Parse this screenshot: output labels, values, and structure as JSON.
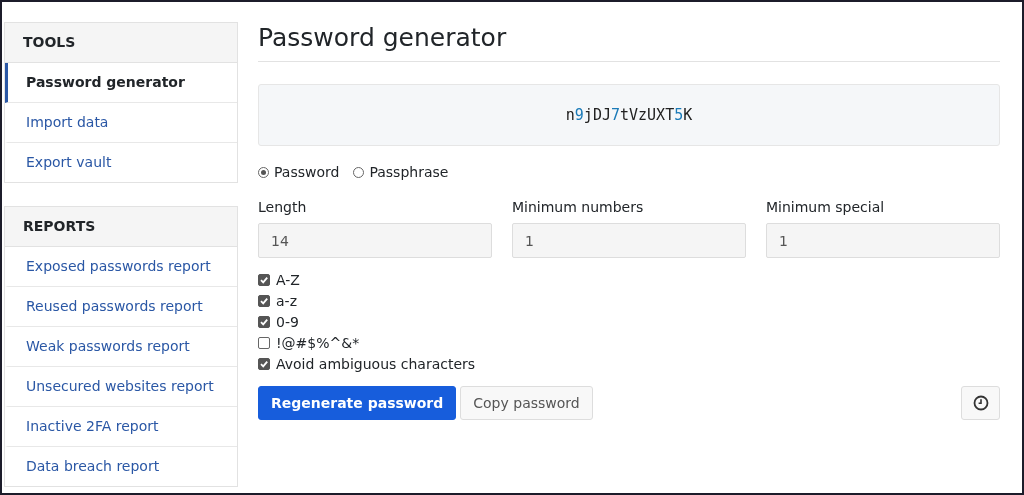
{
  "sidebar": {
    "sections": [
      {
        "heading": "TOOLS",
        "items": [
          {
            "label": "Password generator",
            "selected": true
          },
          {
            "label": "Import data",
            "selected": false
          },
          {
            "label": "Export vault",
            "selected": false
          }
        ]
      },
      {
        "heading": "REPORTS",
        "items": [
          {
            "label": "Exposed passwords report",
            "selected": false
          },
          {
            "label": "Reused passwords report",
            "selected": false
          },
          {
            "label": "Weak passwords report",
            "selected": false
          },
          {
            "label": "Unsecured websites report",
            "selected": false
          },
          {
            "label": "Inactive 2FA report",
            "selected": false
          },
          {
            "label": "Data breach report",
            "selected": false
          }
        ]
      }
    ]
  },
  "page_title": "Password generator",
  "generated_password": "n9jDJ7tVzUXT5K",
  "type_options": [
    {
      "label": "Password",
      "selected": true
    },
    {
      "label": "Passphrase",
      "selected": false
    }
  ],
  "fields": [
    {
      "label": "Length",
      "value": "14"
    },
    {
      "label": "Minimum numbers",
      "value": "1"
    },
    {
      "label": "Minimum special",
      "value": "1"
    }
  ],
  "options": [
    {
      "label": "A-Z",
      "checked": true
    },
    {
      "label": "a-z",
      "checked": true
    },
    {
      "label": "0-9",
      "checked": true
    },
    {
      "label": "!@#$%^&*",
      "checked": false
    },
    {
      "label": "Avoid ambiguous characters",
      "checked": true
    }
  ],
  "buttons": [
    {
      "label": "Regenerate password",
      "kind": "primary"
    },
    {
      "label": "Copy password",
      "kind": "secondary"
    }
  ]
}
